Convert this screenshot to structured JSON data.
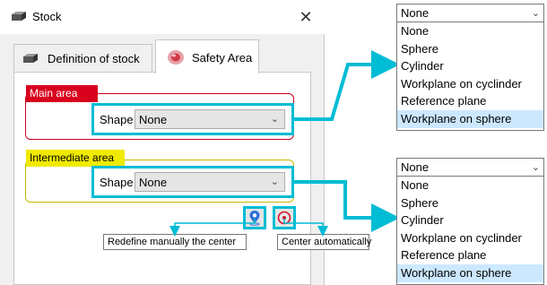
{
  "dialog": {
    "title": "Stock",
    "close_glyph": "✕"
  },
  "tabs": [
    {
      "label": "Definition of stock",
      "icon": "stock-box-icon"
    },
    {
      "label": "Safety Area",
      "icon": "safety-area-icon",
      "active": true
    }
  ],
  "main_area": {
    "label": "Main area",
    "shape_label": "Shape",
    "shape_value": "None",
    "accent_color": "#d8001e"
  },
  "intermediate_area": {
    "label": "Intermediate area",
    "shape_label": "Shape",
    "shape_value": "None",
    "accent_color": "#f0ea00"
  },
  "buttons": {
    "redefine_icon": "location-pin-icon",
    "center_icon": "target-center-icon"
  },
  "tooltips": {
    "redefine": "Redefine manually the center",
    "center": "Center automatically"
  },
  "dropdown_top": {
    "selected": "None",
    "options": [
      "None",
      "Sphere",
      "Cylinder",
      "Workplane on cyclinder",
      "Reference plane",
      "Workplane on sphere"
    ],
    "highlighted": "Workplane on sphere"
  },
  "dropdown_bottom": {
    "selected": "None",
    "options": [
      "None",
      "Sphere",
      "Cylinder",
      "Workplane on cyclinder",
      "Reference plane",
      "Workplane on sphere"
    ],
    "highlighted": "Workplane on sphere"
  },
  "colors": {
    "connector": "#00bcd4",
    "selection": "#cce8ff"
  }
}
